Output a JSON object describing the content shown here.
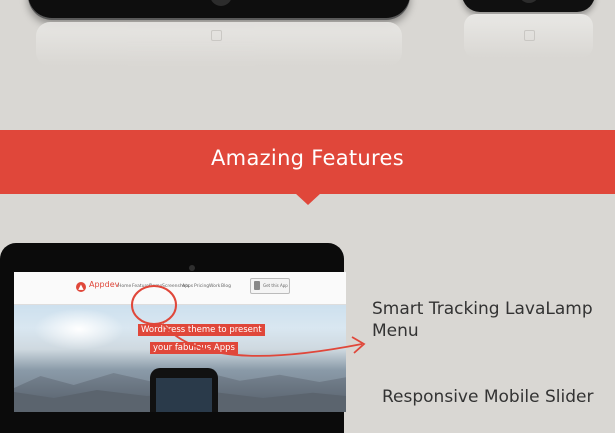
{
  "banner": {
    "title": "Amazing Features",
    "color": "#e0473a"
  },
  "laptop_site": {
    "logo": "Appdev",
    "nav": [
      "Home",
      "Features",
      "Demo",
      "Screenshots",
      "Apps",
      "Pricing",
      "Work",
      "Blog"
    ],
    "cta": "Get this App",
    "headline_line1": "WordPress theme to present",
    "headline_line2": "your fabulous Apps"
  },
  "features": [
    {
      "line1": "Smart Tracking LavaLamp",
      "line2": "Menu"
    },
    {
      "line1": "Responsive Mobile Slider",
      "line2": ""
    }
  ],
  "icons": [
    "home-button-icon",
    "arrow-icon",
    "logo-icon"
  ]
}
